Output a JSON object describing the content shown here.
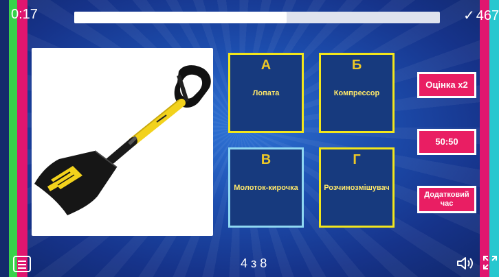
{
  "header": {
    "timer": "0:17",
    "progress_fraction": 0.58,
    "score": "467",
    "check_symbol": "✓"
  },
  "question": {
    "image_icon": "shovel-image"
  },
  "answers": [
    {
      "letter": "А",
      "label": "Лопата",
      "selected": false
    },
    {
      "letter": "Б",
      "label": "Компрессор",
      "selected": false
    },
    {
      "letter": "В",
      "label": "Молоток-кирочка",
      "selected": true
    },
    {
      "letter": "Г",
      "label": "Розчинозмішувач",
      "selected": false
    }
  ],
  "powerups": {
    "double_score": "Оцінка x2",
    "fifty_fifty": "50:50",
    "extra_time": "Додатковий час"
  },
  "footer": {
    "page_counter": "4 з 8",
    "menu_icon": "hamburger-menu-icon",
    "sound_icon": "speaker-icon",
    "fullscreen_icon": "fullscreen-icon"
  },
  "colors": {
    "accent_pink": "#e91e63",
    "answer_border": "#f2e61c",
    "selected_border": "#8fd8f2",
    "letter_color": "#ecc827"
  }
}
